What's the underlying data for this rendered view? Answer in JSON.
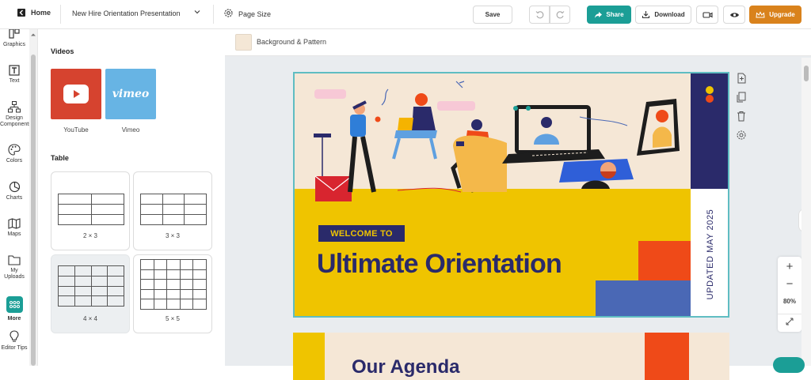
{
  "topbar": {
    "home_label": "Home",
    "doc_title": "New Hire Orientation Presentation",
    "page_size_label": "Page Size",
    "save_label": "Save",
    "share_label": "Share",
    "download_label": "Download",
    "upgrade_label": "Upgrade"
  },
  "rail": {
    "items": [
      {
        "label": "Graphics",
        "icon": "shapes-icon"
      },
      {
        "label": "Text",
        "icon": "text-icon"
      },
      {
        "label": "Design Components",
        "icon": "components-icon"
      },
      {
        "label": "Colors",
        "icon": "palette-icon"
      },
      {
        "label": "Charts",
        "icon": "pie-chart-icon"
      },
      {
        "label": "Maps",
        "icon": "map-icon"
      },
      {
        "label": "My Uploads",
        "icon": "folder-icon"
      },
      {
        "label": "More",
        "icon": "grid-icon"
      },
      {
        "label": "Editor Tips",
        "icon": "lightbulb-icon"
      }
    ]
  },
  "panel": {
    "videos_title": "Videos",
    "videos": [
      {
        "label": "YouTube",
        "color": "#d6432f"
      },
      {
        "label": "Vimeo",
        "color": "#67b4e4",
        "logo_text": "vimeo"
      }
    ],
    "table_title": "Table",
    "tables": [
      {
        "label": "2 × 3",
        "rows": 3,
        "cols": 2
      },
      {
        "label": "3 × 3",
        "rows": 3,
        "cols": 3
      },
      {
        "label": "4 × 4",
        "rows": 4,
        "cols": 4
      },
      {
        "label": "5 × 5",
        "rows": 5,
        "cols": 5
      }
    ]
  },
  "canvas": {
    "background_label": "Background & Pattern",
    "slide1": {
      "badge": "WELCOME TO",
      "title": "Ultimate Orientation",
      "vertical_text": "UPDATED MAY 2025"
    },
    "slide2": {
      "title": "Our Agenda"
    },
    "zoom": {
      "plus": "+",
      "minus": "−",
      "level": "80%"
    }
  },
  "colors": {
    "accent_teal": "#1b9e96",
    "upgrade_orange": "#d9821c",
    "slide_navy": "#2a2a6a",
    "slide_yellow": "#efc400",
    "slide_orange": "#ef4a18",
    "slide_blue": "#4a68b5",
    "selection": "#5fbdc2"
  }
}
